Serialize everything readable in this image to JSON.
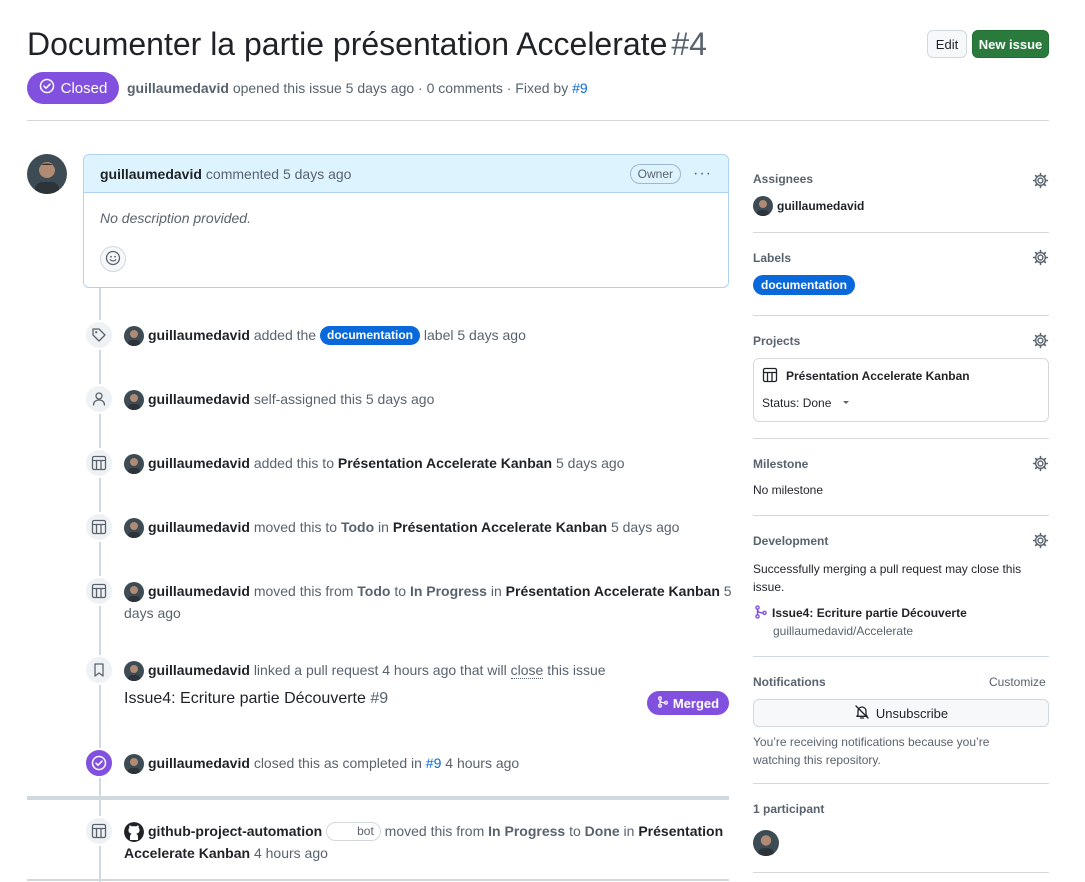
{
  "header": {
    "title": "Documenter la partie présentation Accelerate",
    "number": "#4",
    "edit_label": "Edit",
    "new_issue_label": "New issue",
    "state": "Closed",
    "author": "guillaumedavid",
    "opened_text": "opened this issue 5 days ago · 0 comments · Fixed by",
    "fixed_by": "#9"
  },
  "comment": {
    "author": "guillaumedavid",
    "action": "commented 5 days ago",
    "role_badge": "Owner",
    "body": "No description provided."
  },
  "events": {
    "labeled": {
      "actor": "guillaumedavid",
      "pre": "added the",
      "label": "documentation",
      "post": "label 5 days ago"
    },
    "assigned": {
      "actor": "guillaumedavid",
      "text": "self-assigned this 5 days ago"
    },
    "project_added": {
      "actor": "guillaumedavid",
      "pre": "added this to",
      "project": "Présentation Accelerate Kanban",
      "post": "5 days ago"
    },
    "moved_todo": {
      "actor": "guillaumedavid",
      "pre": "moved this to",
      "column": "Todo",
      "mid": "in",
      "project": "Présentation Accelerate Kanban",
      "post": "5 days ago"
    },
    "moved_progress": {
      "actor": "guillaumedavid",
      "pre": "moved this from",
      "from": "Todo",
      "to_word": "to",
      "to": "In Progress",
      "mid": "in",
      "project": "Présentation Accelerate Kanban",
      "post": "5 days ago"
    },
    "linked_pr": {
      "actor": "guillaumedavid",
      "pre": "linked a pull request 4 hours ago that will",
      "keyword": "close",
      "post": "this issue",
      "pr_title": "Issue4: Ecriture partie Découverte",
      "pr_number": "#9",
      "pr_state": "Merged"
    },
    "closed": {
      "actor": "guillaumedavid",
      "pre": "closed this as completed in",
      "ref": "#9",
      "post": "4 hours ago"
    },
    "bot_moved": {
      "actor": "github-project-automation",
      "bot_badge": "bot",
      "pre": "moved this from",
      "from": "In Progress",
      "to_word": "to",
      "to": "Done",
      "mid": "in",
      "project": "Présentation Accelerate Kanban",
      "post": "4 hours ago"
    }
  },
  "sidebar": {
    "assignees": {
      "title": "Assignees",
      "name": "guillaumedavid"
    },
    "labels": {
      "title": "Labels",
      "label": "documentation"
    },
    "projects": {
      "title": "Projects",
      "project_name": "Présentation Accelerate Kanban",
      "status": "Status: Done"
    },
    "milestone": {
      "title": "Milestone",
      "value": "No milestone"
    },
    "development": {
      "title": "Development",
      "desc": "Successfully merging a pull request may close this issue.",
      "pr_title": "Issue4: Ecriture partie Découverte",
      "pr_repo": "guillaumedavid/Accelerate"
    },
    "notifications": {
      "title": "Notifications",
      "customize": "Customize",
      "button": "Unsubscribe",
      "desc": "You’re receiving notifications because you’re watching this repository."
    },
    "participants": {
      "title": "1 participant"
    }
  },
  "colors": {
    "closed_purple": "#8250df",
    "primary_green": "#2b7a3d",
    "label_blue": "#0969da",
    "comment_header": "#ddf4ff"
  }
}
